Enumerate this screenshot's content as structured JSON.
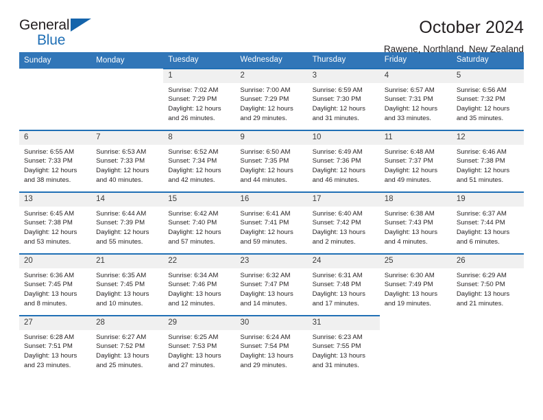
{
  "logo": {
    "word1": "General",
    "word2": "Blue",
    "triangle_color": "#1464ab",
    "word2_color": "#1f6fb5",
    "icon": "general-blue-logo"
  },
  "header": {
    "title": "October 2024",
    "subtitle": "Rawene, Northland, New Zealand"
  },
  "theme": {
    "header_bg": "#3176b8",
    "row_border": "#1f6fb5",
    "daynum_bg": "#f0f0f0",
    "text": "#231f20"
  },
  "weekday_headers": [
    "Sunday",
    "Monday",
    "Tuesday",
    "Wednesday",
    "Thursday",
    "Friday",
    "Saturday"
  ],
  "labels": {
    "sunrise": "Sunrise:",
    "sunset": "Sunset:",
    "daylight": "Daylight:"
  },
  "weeks": [
    [
      {
        "day": "",
        "sunrise": "",
        "sunset": "",
        "daylight": "",
        "empty": true
      },
      {
        "day": "",
        "sunrise": "",
        "sunset": "",
        "daylight": "",
        "empty": true
      },
      {
        "day": "1",
        "sunrise": "Sunrise: 7:02 AM",
        "sunset": "Sunset: 7:29 PM",
        "daylight": "Daylight: 12 hours and 26 minutes."
      },
      {
        "day": "2",
        "sunrise": "Sunrise: 7:00 AM",
        "sunset": "Sunset: 7:29 PM",
        "daylight": "Daylight: 12 hours and 29 minutes."
      },
      {
        "day": "3",
        "sunrise": "Sunrise: 6:59 AM",
        "sunset": "Sunset: 7:30 PM",
        "daylight": "Daylight: 12 hours and 31 minutes."
      },
      {
        "day": "4",
        "sunrise": "Sunrise: 6:57 AM",
        "sunset": "Sunset: 7:31 PM",
        "daylight": "Daylight: 12 hours and 33 minutes."
      },
      {
        "day": "5",
        "sunrise": "Sunrise: 6:56 AM",
        "sunset": "Sunset: 7:32 PM",
        "daylight": "Daylight: 12 hours and 35 minutes."
      }
    ],
    [
      {
        "day": "6",
        "sunrise": "Sunrise: 6:55 AM",
        "sunset": "Sunset: 7:33 PM",
        "daylight": "Daylight: 12 hours and 38 minutes."
      },
      {
        "day": "7",
        "sunrise": "Sunrise: 6:53 AM",
        "sunset": "Sunset: 7:33 PM",
        "daylight": "Daylight: 12 hours and 40 minutes."
      },
      {
        "day": "8",
        "sunrise": "Sunrise: 6:52 AM",
        "sunset": "Sunset: 7:34 PM",
        "daylight": "Daylight: 12 hours and 42 minutes."
      },
      {
        "day": "9",
        "sunrise": "Sunrise: 6:50 AM",
        "sunset": "Sunset: 7:35 PM",
        "daylight": "Daylight: 12 hours and 44 minutes."
      },
      {
        "day": "10",
        "sunrise": "Sunrise: 6:49 AM",
        "sunset": "Sunset: 7:36 PM",
        "daylight": "Daylight: 12 hours and 46 minutes."
      },
      {
        "day": "11",
        "sunrise": "Sunrise: 6:48 AM",
        "sunset": "Sunset: 7:37 PM",
        "daylight": "Daylight: 12 hours and 49 minutes."
      },
      {
        "day": "12",
        "sunrise": "Sunrise: 6:46 AM",
        "sunset": "Sunset: 7:38 PM",
        "daylight": "Daylight: 12 hours and 51 minutes."
      }
    ],
    [
      {
        "day": "13",
        "sunrise": "Sunrise: 6:45 AM",
        "sunset": "Sunset: 7:38 PM",
        "daylight": "Daylight: 12 hours and 53 minutes."
      },
      {
        "day": "14",
        "sunrise": "Sunrise: 6:44 AM",
        "sunset": "Sunset: 7:39 PM",
        "daylight": "Daylight: 12 hours and 55 minutes."
      },
      {
        "day": "15",
        "sunrise": "Sunrise: 6:42 AM",
        "sunset": "Sunset: 7:40 PM",
        "daylight": "Daylight: 12 hours and 57 minutes."
      },
      {
        "day": "16",
        "sunrise": "Sunrise: 6:41 AM",
        "sunset": "Sunset: 7:41 PM",
        "daylight": "Daylight: 12 hours and 59 minutes."
      },
      {
        "day": "17",
        "sunrise": "Sunrise: 6:40 AM",
        "sunset": "Sunset: 7:42 PM",
        "daylight": "Daylight: 13 hours and 2 minutes."
      },
      {
        "day": "18",
        "sunrise": "Sunrise: 6:38 AM",
        "sunset": "Sunset: 7:43 PM",
        "daylight": "Daylight: 13 hours and 4 minutes."
      },
      {
        "day": "19",
        "sunrise": "Sunrise: 6:37 AM",
        "sunset": "Sunset: 7:44 PM",
        "daylight": "Daylight: 13 hours and 6 minutes."
      }
    ],
    [
      {
        "day": "20",
        "sunrise": "Sunrise: 6:36 AM",
        "sunset": "Sunset: 7:45 PM",
        "daylight": "Daylight: 13 hours and 8 minutes."
      },
      {
        "day": "21",
        "sunrise": "Sunrise: 6:35 AM",
        "sunset": "Sunset: 7:45 PM",
        "daylight": "Daylight: 13 hours and 10 minutes."
      },
      {
        "day": "22",
        "sunrise": "Sunrise: 6:34 AM",
        "sunset": "Sunset: 7:46 PM",
        "daylight": "Daylight: 13 hours and 12 minutes."
      },
      {
        "day": "23",
        "sunrise": "Sunrise: 6:32 AM",
        "sunset": "Sunset: 7:47 PM",
        "daylight": "Daylight: 13 hours and 14 minutes."
      },
      {
        "day": "24",
        "sunrise": "Sunrise: 6:31 AM",
        "sunset": "Sunset: 7:48 PM",
        "daylight": "Daylight: 13 hours and 17 minutes."
      },
      {
        "day": "25",
        "sunrise": "Sunrise: 6:30 AM",
        "sunset": "Sunset: 7:49 PM",
        "daylight": "Daylight: 13 hours and 19 minutes."
      },
      {
        "day": "26",
        "sunrise": "Sunrise: 6:29 AM",
        "sunset": "Sunset: 7:50 PM",
        "daylight": "Daylight: 13 hours and 21 minutes."
      }
    ],
    [
      {
        "day": "27",
        "sunrise": "Sunrise: 6:28 AM",
        "sunset": "Sunset: 7:51 PM",
        "daylight": "Daylight: 13 hours and 23 minutes."
      },
      {
        "day": "28",
        "sunrise": "Sunrise: 6:27 AM",
        "sunset": "Sunset: 7:52 PM",
        "daylight": "Daylight: 13 hours and 25 minutes."
      },
      {
        "day": "29",
        "sunrise": "Sunrise: 6:25 AM",
        "sunset": "Sunset: 7:53 PM",
        "daylight": "Daylight: 13 hours and 27 minutes."
      },
      {
        "day": "30",
        "sunrise": "Sunrise: 6:24 AM",
        "sunset": "Sunset: 7:54 PM",
        "daylight": "Daylight: 13 hours and 29 minutes."
      },
      {
        "day": "31",
        "sunrise": "Sunrise: 6:23 AM",
        "sunset": "Sunset: 7:55 PM",
        "daylight": "Daylight: 13 hours and 31 minutes."
      },
      {
        "day": "",
        "sunrise": "",
        "sunset": "",
        "daylight": "",
        "empty": true
      },
      {
        "day": "",
        "sunrise": "",
        "sunset": "",
        "daylight": "",
        "empty": true
      }
    ]
  ]
}
